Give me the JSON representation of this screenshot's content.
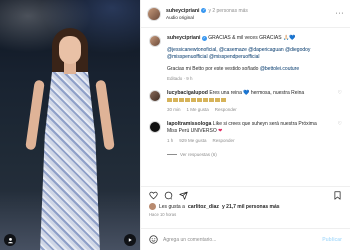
{
  "header": {
    "username": "suheycipriani",
    "collab_text": "y 2 personas más",
    "audio": "Audio original"
  },
  "caption": {
    "username": "suheycipriani",
    "text": "GRACIAS & mil veces GRACIAS 🙏🏻💙",
    "mentions": "@jessicanewtonoficial, @casemaze @dapericaguan @diegodoy @misspenuofficial @misspendperuofficial",
    "extra": "Gracias mi Betto por este vestido soñado",
    "mention_end": "@bettolei.couture",
    "meta": "Editado · 9 h"
  },
  "comments": [
    {
      "username": "lucybacigalupod",
      "text": "Eres una reina 💙 hermosa, nuestra Reina",
      "time": "30 min",
      "likes": "1 Me gusta",
      "reply": "Responder"
    },
    {
      "username": "lapoltramissologa",
      "text": "Like si crees que suheyn será nuestra Próxima Miss Perú UNIVERSO",
      "time": "1 h",
      "likes": "929 Me gusta",
      "reply": "Responder",
      "view_replies": "Ver respuestas (6)"
    }
  ],
  "likes": {
    "prefix": "Les gusta a",
    "user": "carlitoz_diaz",
    "suffix": "y 21,7 mil personas más"
  },
  "time_ago": "Hace 10 horas",
  "comment_input": {
    "placeholder": "Agrega un comentario...",
    "post_label": "Publicar"
  },
  "icons": {
    "like": "heart-icon",
    "comment": "comment-icon",
    "share": "share-icon",
    "save": "bookmark-icon",
    "more": "more-icon",
    "emoji": "emoji-icon",
    "user": "user-icon",
    "play": "play-icon"
  }
}
